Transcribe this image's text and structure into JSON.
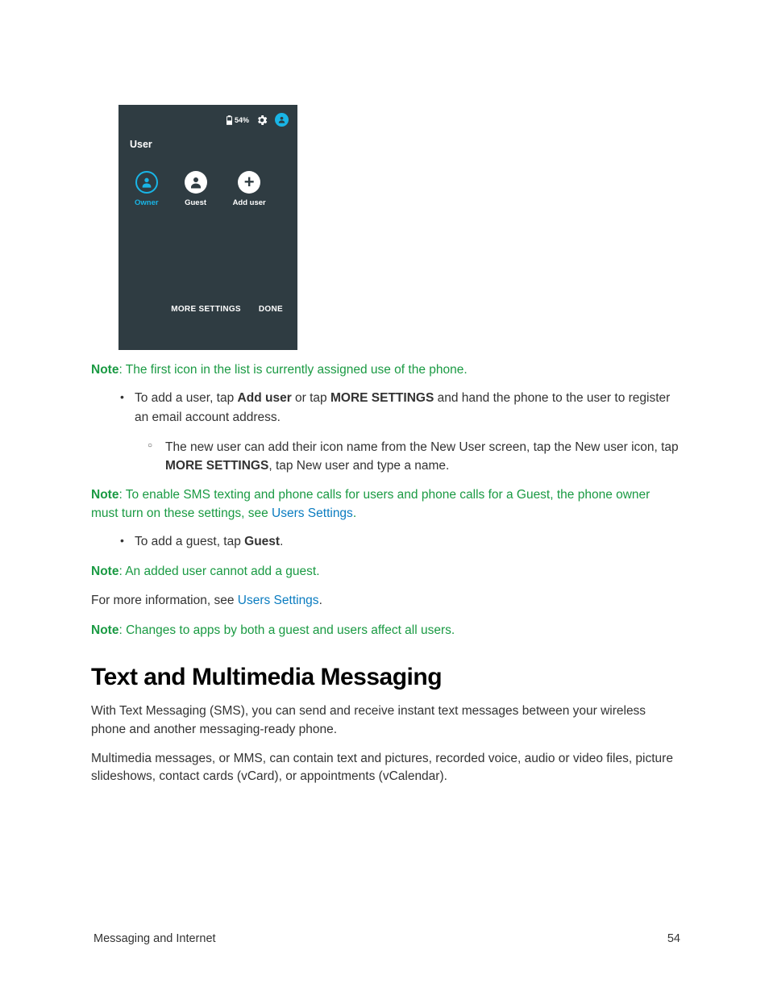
{
  "phone": {
    "battery_pct": "54%",
    "title": "User",
    "users": [
      {
        "label": "Owner"
      },
      {
        "label": "Guest"
      },
      {
        "label": "Add user"
      }
    ],
    "btn_more": "MORE SETTINGS",
    "btn_done": "DONE"
  },
  "notes": {
    "n1_a": "Note",
    "n1_b": ": The first icon in the list is currently assigned use of the phone.",
    "n2_a": "Note",
    "n2_b": ": To enable SMS texting and phone calls for users and phone calls for a Guest, the phone owner must turn on these settings, see ",
    "n2_link": "Users Settings",
    "n2_c": ".",
    "n3_a": "Note",
    "n3_b": ": An added user cannot add a guest.",
    "n4_a": "Note",
    "n4_b": ": Changes to apps by both a guest and users affect all users."
  },
  "bullets": {
    "b1_a": "To add a user, tap ",
    "b1_b": "Add user",
    "b1_c": " or tap ",
    "b1_d": "MORE SETTINGS",
    "b1_e": " and hand the phone to the user to register an email account address.",
    "b1_sub_a": "The new user can add their icon name from the New User screen, tap the New user icon, tap ",
    "b1_sub_b": "MORE SETTINGS",
    "b1_sub_c": ", tap New user and type a name.",
    "b2_a": "To add a guest, tap ",
    "b2_b": "Guest",
    "b2_c": "."
  },
  "para": {
    "more_a": "For more information, see ",
    "more_link": "Users Settings",
    "more_b": "."
  },
  "section": {
    "heading": "Text and Multimedia Messaging",
    "p1": "With Text Messaging (SMS), you can send and receive instant text messages between your wireless phone and another messaging-ready phone.",
    "p2": "Multimedia messages, or MMS, can contain text and pictures, recorded voice, audio or video files, picture slideshows, contact cards (vCard), or appointments (vCalendar)."
  },
  "footer": {
    "left": "Messaging and Internet",
    "right": "54"
  }
}
